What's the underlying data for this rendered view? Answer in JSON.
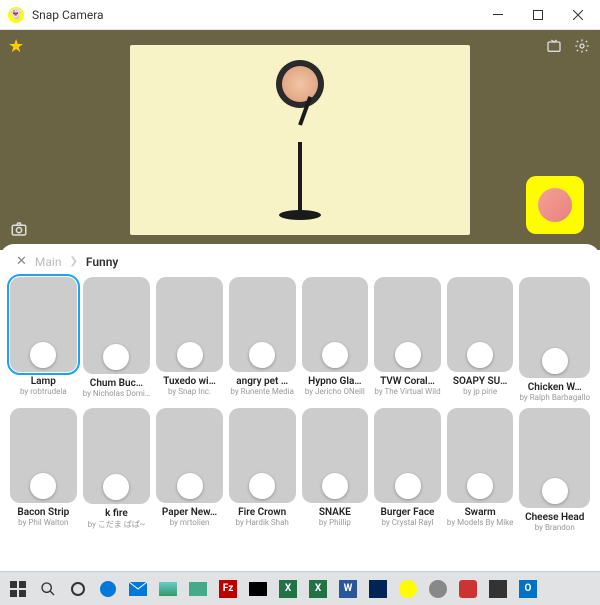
{
  "window": {
    "title": "Snap Camera"
  },
  "breadcrumb": {
    "root": "Main",
    "current": "Funny"
  },
  "lenses": {
    "row1": [
      {
        "name": "Lamp",
        "author": "by robtrudela",
        "selected": true
      },
      {
        "name": "Chum Buc…",
        "author": "by Nicholas Domi…"
      },
      {
        "name": "Tuxedo wi…",
        "author": "by Snap Inc."
      },
      {
        "name": "angry pet …",
        "author": "by Runente Media"
      },
      {
        "name": "Hypno Gla…",
        "author": "by Jericho ONeill"
      },
      {
        "name": "TVW Coral…",
        "author": "by The Virtual Wild"
      },
      {
        "name": "SOAPY SU…",
        "author": "by jp pirie"
      },
      {
        "name": "Chicken W…",
        "author": "by Ralph Barbagallo"
      }
    ],
    "row2": [
      {
        "name": "Bacon Strip",
        "author": "by Phil Walton"
      },
      {
        "name": "k fire",
        "author": "by こだま ぱぱ~"
      },
      {
        "name": "Paper New…",
        "author": "by mrtolien"
      },
      {
        "name": "Fire Crown",
        "author": "by Hardik Shah"
      },
      {
        "name": "SNAKE",
        "author": "by Phillip"
      },
      {
        "name": "Burger Face",
        "author": "by Crystal Rayl"
      },
      {
        "name": "Swarm",
        "author": "by Models By Mike"
      },
      {
        "name": "Cheese Head",
        "author": "by Brandon"
      }
    ]
  },
  "taskbar": {
    "items": [
      "start",
      "search",
      "cortana",
      "edge",
      "mail",
      "photo",
      "fm",
      "fz",
      "terminal",
      "excel",
      "excel2",
      "word",
      "powershell",
      "snap",
      "app1",
      "app2",
      "app3",
      "outlook"
    ]
  }
}
